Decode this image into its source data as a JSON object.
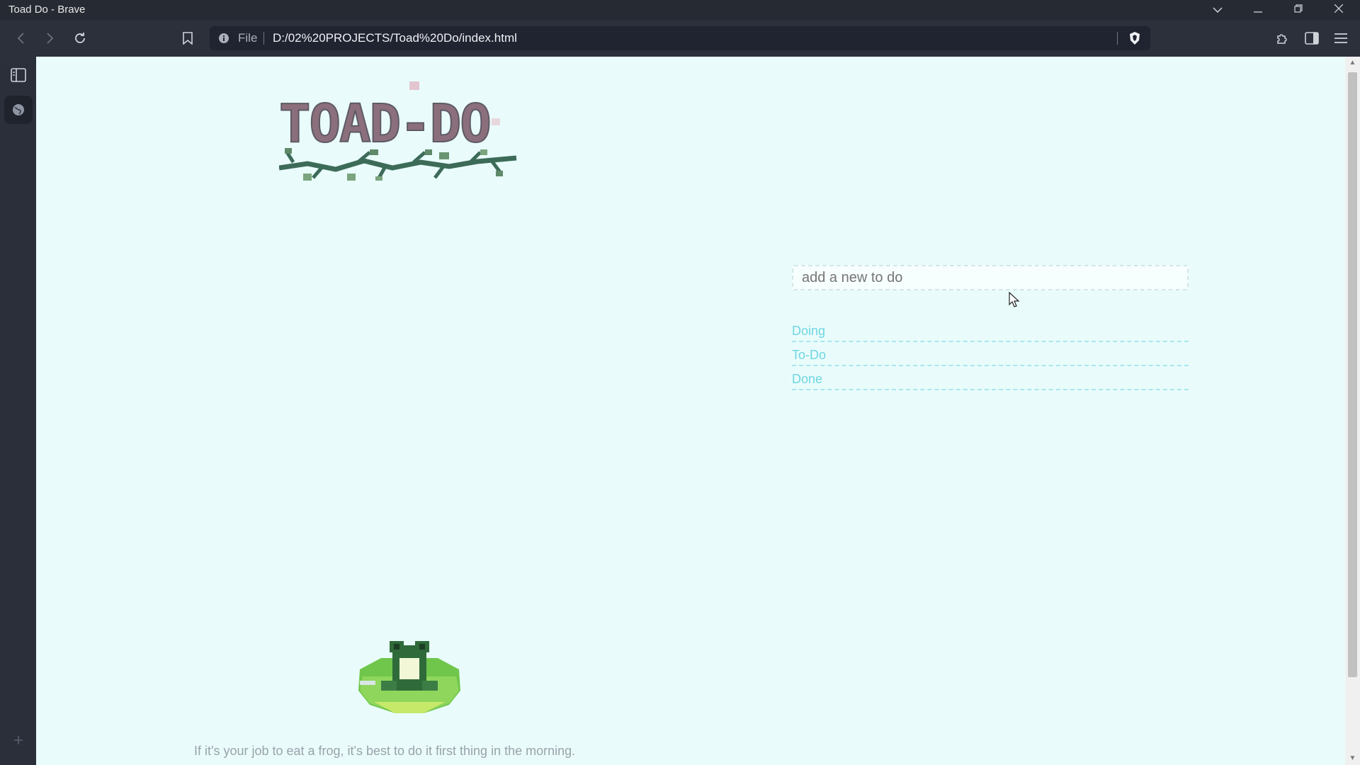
{
  "window": {
    "title": "Toad Do - Brave",
    "controls": [
      "chevron-down-icon",
      "minimize-icon",
      "restore-icon",
      "close-icon"
    ]
  },
  "toolbar": {
    "url_scheme": "File",
    "url": "D:/02%20PROJECTS/Toad%20Do/index.html"
  },
  "page": {
    "logo_text": "TOAD-DO",
    "input_placeholder": "add a new to do",
    "sections": [
      "Doing",
      "To-Do",
      "Done"
    ],
    "quote": "If it's your job to eat a frog, it's best to do it first thing in the morning."
  },
  "colors": {
    "page_bg": "#e9fcfb",
    "section_text": "#6fd6e2",
    "section_line": "#a7e6ee",
    "chrome_bg": "#2c303b"
  }
}
